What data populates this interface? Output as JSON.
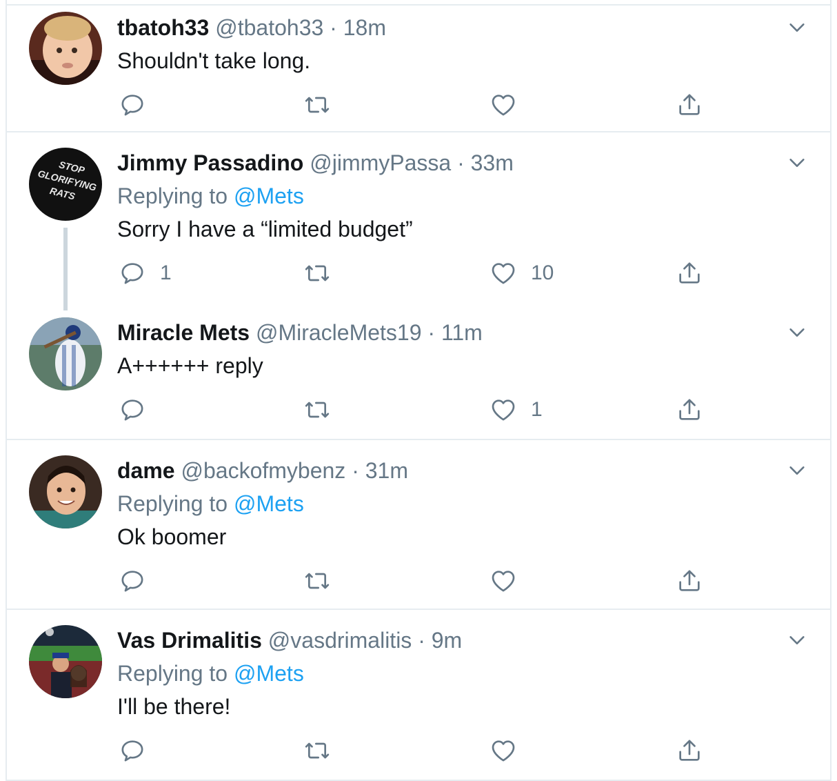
{
  "tweets": [
    {
      "name": "tbatoh33",
      "handle": "@tbatoh33",
      "time": "18m",
      "replying_label": "",
      "replying_mention": "",
      "text": "Shouldn't take long.",
      "reply_count": "",
      "like_count": ""
    },
    {
      "name": "Jimmy Passadino",
      "handle": "@jimmyPassa",
      "time": "33m",
      "replying_label": "Replying to",
      "replying_mention": "@Mets",
      "text": "Sorry I have a “limited budget”",
      "reply_count": "1",
      "like_count": "10",
      "avatar_text": [
        "STOP",
        "GLORIFYING",
        "RATS"
      ]
    },
    {
      "name": "Miracle Mets",
      "handle": "@MiracleMets19",
      "time": "11m",
      "replying_label": "",
      "replying_mention": "",
      "text": "A++++++ reply",
      "reply_count": "",
      "like_count": "1"
    },
    {
      "name": "dame",
      "handle": "@backofmybenz",
      "time": "31m",
      "replying_label": "Replying to",
      "replying_mention": "@Mets",
      "text": "Ok boomer",
      "reply_count": "",
      "like_count": ""
    },
    {
      "name": "Vas Drimalitis",
      "handle": "@vasdrimalitis",
      "time": "9m",
      "replying_label": "Replying to",
      "replying_mention": "@Mets",
      "text": "I'll be there!",
      "reply_count": "",
      "like_count": ""
    }
  ],
  "separator": " · ",
  "colors": {
    "name": "#14171a",
    "meta": "#657786",
    "mention": "#1da1f2",
    "border": "#e6ecf0",
    "thread_line": "#ccd6dd"
  },
  "icons": [
    "reply-icon",
    "retweet-icon",
    "like-icon",
    "share-icon",
    "chevron-down-icon"
  ]
}
